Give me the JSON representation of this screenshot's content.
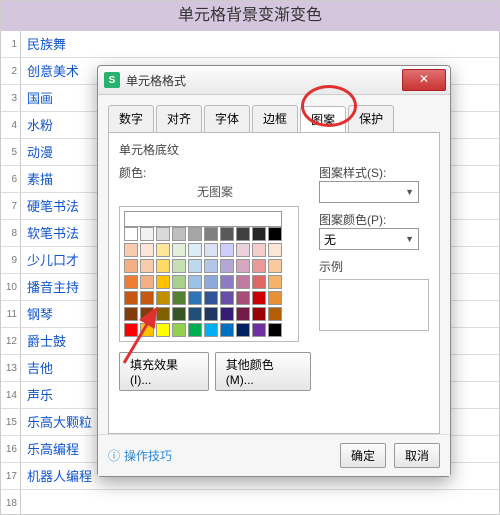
{
  "header_title": "单元格背景变渐变色",
  "rows": [
    "民族舞",
    "创意美术",
    "国画",
    "水粉",
    "动漫",
    "素描",
    "硬笔书法",
    "软笔书法",
    "少儿口才",
    "播音主持",
    "钢琴",
    "爵士鼓",
    "吉他",
    "声乐",
    "乐高大颗粒",
    "乐高编程",
    "机器人编程"
  ],
  "dialog": {
    "title": "单元格格式",
    "tabs": [
      "数字",
      "对齐",
      "字体",
      "边框",
      "图案",
      "保护"
    ],
    "active_tab_index": 4,
    "section_heading": "单元格底纹",
    "color_label": "颜色:",
    "no_pattern_text": "无图案",
    "fill_effect_btn": "填充效果(I)...",
    "other_color_btn": "其他颜色(M)...",
    "pattern_style_label": "图案样式(S):",
    "pattern_color_label": "图案颜色(P):",
    "pattern_color_value": "无",
    "sample_label": "示例",
    "tip_text": "操作技巧",
    "ok_btn": "确定",
    "cancel_btn": "取消",
    "palette_rows": [
      [
        "#ffffff",
        "#f2f2f2",
        "#d9d9d9",
        "#bfbfbf",
        "#a6a6a6",
        "#808080",
        "#595959",
        "#404040",
        "#262626",
        "#000000"
      ],
      [
        "#f8cbad",
        "#fce4d6",
        "#ffe699",
        "#e2efda",
        "#ddebf7",
        "#d9e1f2",
        "#ccccff",
        "#ead1dc",
        "#f4cccc",
        "#fbe5d6"
      ],
      [
        "#f4b084",
        "#f8cbad",
        "#ffd966",
        "#c6e0b4",
        "#bdd7ee",
        "#b4c6e7",
        "#b4a7d6",
        "#d5a6bd",
        "#ea9999",
        "#f9cb9c"
      ],
      [
        "#ed7d31",
        "#f4b084",
        "#ffc000",
        "#a9d08e",
        "#9bc2e6",
        "#8ea9db",
        "#8e7cc3",
        "#c27ba0",
        "#e06666",
        "#f6b26b"
      ],
      [
        "#c65911",
        "#c65911",
        "#bf8f00",
        "#548235",
        "#2f75b5",
        "#305496",
        "#674ea7",
        "#a64d79",
        "#cc0000",
        "#e69138"
      ],
      [
        "#833c0c",
        "#833c0c",
        "#806000",
        "#375623",
        "#1f4e78",
        "#203764",
        "#351c75",
        "#741b47",
        "#990000",
        "#b45f06"
      ],
      [
        "#ff0000",
        "#ffc000",
        "#ffff00",
        "#92d050",
        "#00b050",
        "#00b0f0",
        "#0070c0",
        "#002060",
        "#7030a0",
        "#000000"
      ]
    ]
  }
}
